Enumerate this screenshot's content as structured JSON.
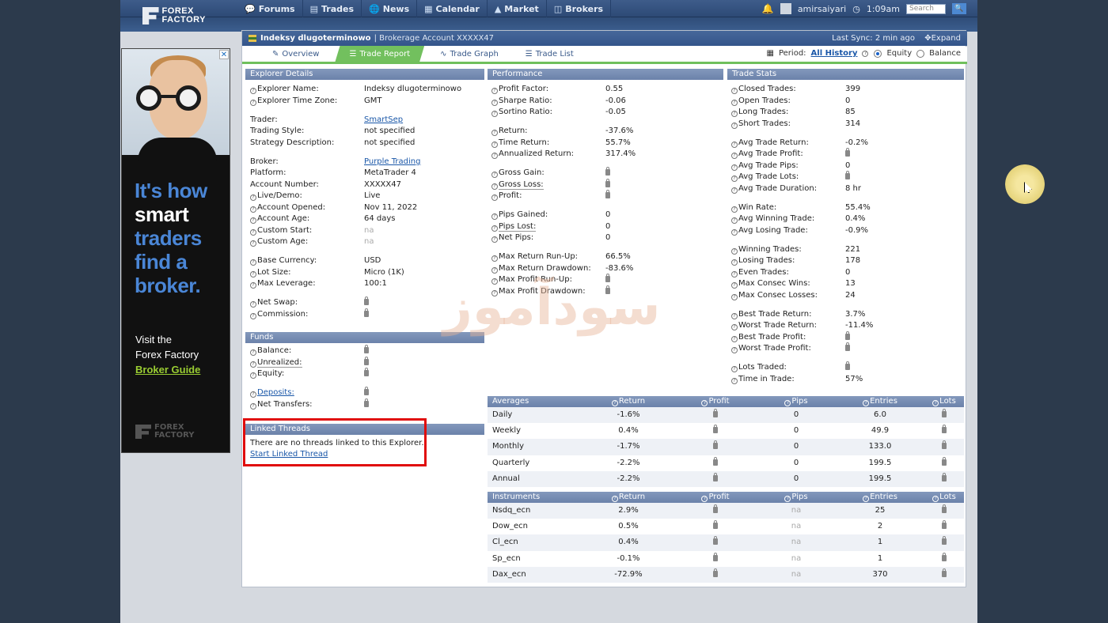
{
  "nav": {
    "logo_line1": "FOREX",
    "logo_line2": "FACTORY",
    "items": [
      {
        "label": "Forums",
        "icon": "forums-icon"
      },
      {
        "label": "Trades",
        "icon": "trades-icon"
      },
      {
        "label": "News",
        "icon": "news-icon"
      },
      {
        "label": "Calendar",
        "icon": "calendar-icon"
      },
      {
        "label": "Market",
        "icon": "market-icon"
      },
      {
        "label": "Brokers",
        "icon": "brokers-icon"
      }
    ],
    "username": "amirsaiyari",
    "time": "1:09am",
    "search_placeholder": "Search"
  },
  "ad": {
    "line1": "It's how",
    "line2": "smart",
    "line3": "traders",
    "line4": "find a",
    "line5": "broker.",
    "visit1": "Visit the",
    "visit2": "Forex Factory",
    "link": "Broker Guide",
    "foot1": "FOREX",
    "foot2": "FACTORY"
  },
  "explorer": {
    "title": "Indeksy dlugoterminowo",
    "subtitle": "| Brokerage Account XXXXX47",
    "last_sync": "Last Sync: 2 min ago",
    "expand": "Expand",
    "tabs": [
      "Overview",
      "Trade Report",
      "Trade Graph",
      "Trade List"
    ],
    "period_label": "Period:",
    "period_value": "All History",
    "equity": "Equity",
    "balance": "Balance"
  },
  "details": {
    "header": "Explorer Details",
    "rows": [
      {
        "k": "Explorer Name:",
        "v": "Indeksy dlugoterminowo"
      },
      {
        "k": "Explorer Time Zone:",
        "v": "GMT"
      },
      {
        "k": "Trader:",
        "v": "SmartSep"
      },
      {
        "k": "Trading Style:",
        "v": "not specified"
      },
      {
        "k": "Strategy Description:",
        "v": "not specified"
      },
      {
        "k": "Broker:",
        "v": "Purple Trading"
      },
      {
        "k": "Platform:",
        "v": "MetaTrader 4"
      },
      {
        "k": "Account Number:",
        "v": "XXXXX47"
      },
      {
        "k": "Live/Demo:",
        "v": "Live"
      },
      {
        "k": "Account Opened:",
        "v": "Nov 11, 2022"
      },
      {
        "k": "Account Age:",
        "v": "64 days"
      },
      {
        "k": "Custom Start:",
        "v": "na"
      },
      {
        "k": "Custom Age:",
        "v": "na"
      },
      {
        "k": "Base Currency:",
        "v": "USD"
      },
      {
        "k": "Lot Size:",
        "v": "Micro (1K)"
      },
      {
        "k": "Max Leverage:",
        "v": "100:1"
      },
      {
        "k": "Net Swap:",
        "v": ""
      },
      {
        "k": "Commission:",
        "v": ""
      }
    ]
  },
  "funds": {
    "header": "Funds",
    "rows": [
      {
        "k": "Balance:"
      },
      {
        "k": "Unrealized:"
      },
      {
        "k": "Equity:"
      },
      {
        "k": "Deposits:"
      },
      {
        "k": "Net Transfers:"
      }
    ]
  },
  "threads": {
    "header": "Linked Threads",
    "text": "There are no threads linked to this Explorer.",
    "link": "Start Linked Thread"
  },
  "performance": {
    "header": "Performance",
    "rows": [
      {
        "k": "Profit Factor:",
        "v": "0.55"
      },
      {
        "k": "Sharpe Ratio:",
        "v": "-0.06"
      },
      {
        "k": "Sortino Ratio:",
        "v": "-0.05"
      },
      {
        "k": "Return:",
        "v": "-37.6%"
      },
      {
        "k": "Time Return:",
        "v": "55.7%"
      },
      {
        "k": "Annualized Return:",
        "v": "317.4%"
      },
      {
        "k": "Gross Gain:",
        "v": ""
      },
      {
        "k": "Gross Loss:",
        "v": ""
      },
      {
        "k": "Profit:",
        "v": ""
      },
      {
        "k": "Pips Gained:",
        "v": "0"
      },
      {
        "k": "Pips Lost:",
        "v": "0"
      },
      {
        "k": "Net Pips:",
        "v": "0"
      },
      {
        "k": "Max Return Run-Up:",
        "v": "66.5%"
      },
      {
        "k": "Max Return Drawdown:",
        "v": "-83.6%"
      },
      {
        "k": "Max Profit Run-Up:",
        "v": ""
      },
      {
        "k": "Max Profit Drawdown:",
        "v": ""
      }
    ]
  },
  "stats": {
    "header": "Trade Stats",
    "rows": [
      {
        "k": "Closed Trades:",
        "v": "399"
      },
      {
        "k": "Open Trades:",
        "v": "0"
      },
      {
        "k": "Long Trades:",
        "v": "85"
      },
      {
        "k": "Short Trades:",
        "v": "314"
      },
      {
        "k": "Avg Trade Return:",
        "v": "-0.2%"
      },
      {
        "k": "Avg Trade Profit:",
        "v": ""
      },
      {
        "k": "Avg Trade Pips:",
        "v": "0"
      },
      {
        "k": "Avg Trade Lots:",
        "v": ""
      },
      {
        "k": "Avg Trade Duration:",
        "v": "8 hr"
      },
      {
        "k": "Win Rate:",
        "v": "55.4%"
      },
      {
        "k": "Avg Winning Trade:",
        "v": "0.4%"
      },
      {
        "k": "Avg Losing Trade:",
        "v": "-0.9%"
      },
      {
        "k": "Winning Trades:",
        "v": "221"
      },
      {
        "k": "Losing Trades:",
        "v": "178"
      },
      {
        "k": "Even Trades:",
        "v": "0"
      },
      {
        "k": "Max Consec Wins:",
        "v": "13"
      },
      {
        "k": "Max Consec Losses:",
        "v": "24"
      },
      {
        "k": "Best Trade Return:",
        "v": "3.7%"
      },
      {
        "k": "Worst Trade Return:",
        "v": "-11.4%"
      },
      {
        "k": "Best Trade Profit:",
        "v": ""
      },
      {
        "k": "Worst Trade Profit:",
        "v": ""
      },
      {
        "k": "Lots Traded:",
        "v": ""
      },
      {
        "k": "Time in Trade:",
        "v": "57%"
      }
    ]
  },
  "averages": {
    "headers": [
      "Averages",
      "Return",
      "Profit",
      "Pips",
      "Entries",
      "Lots"
    ],
    "rows": [
      [
        "Daily",
        "-1.6%",
        "",
        "0",
        "6.0",
        ""
      ],
      [
        "Weekly",
        "0.4%",
        "",
        "0",
        "49.9",
        ""
      ],
      [
        "Monthly",
        "-1.7%",
        "",
        "0",
        "133.0",
        ""
      ],
      [
        "Quarterly",
        "-2.2%",
        "",
        "0",
        "199.5",
        ""
      ],
      [
        "Annual",
        "-2.2%",
        "",
        "0",
        "199.5",
        ""
      ]
    ]
  },
  "instruments": {
    "headers": [
      "Instruments",
      "Return",
      "Profit",
      "Pips",
      "Entries",
      "Lots"
    ],
    "rows": [
      [
        "Nsdq_ecn",
        "2.9%",
        "",
        "na",
        "25",
        ""
      ],
      [
        "Dow_ecn",
        "0.5%",
        "",
        "na",
        "2",
        ""
      ],
      [
        "Cl_ecn",
        "0.4%",
        "",
        "na",
        "1",
        ""
      ],
      [
        "Sp_ecn",
        "-0.1%",
        "",
        "na",
        "1",
        ""
      ],
      [
        "Dax_ecn",
        "-72.9%",
        "",
        "na",
        "370",
        ""
      ]
    ]
  },
  "watermark": "سودآموز"
}
